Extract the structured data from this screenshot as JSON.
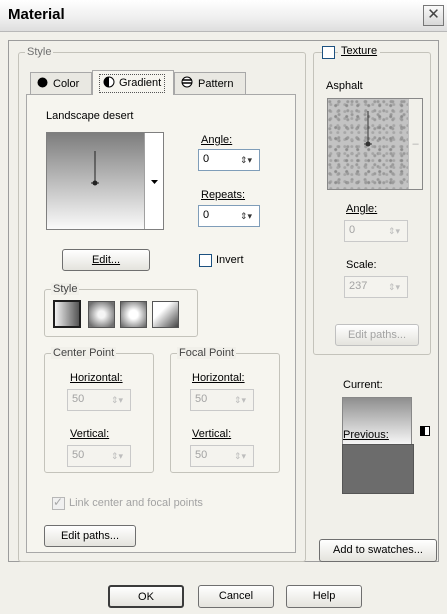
{
  "window": {
    "title": "Material",
    "close_glyph": "✕"
  },
  "style_group": {
    "label": "Style"
  },
  "tabs": [
    {
      "label": "Color",
      "icon": "filled-circle-icon"
    },
    {
      "label": "Gradient",
      "icon": "half-circle-icon"
    },
    {
      "label": "Pattern",
      "icon": "striped-circle-icon"
    }
  ],
  "gradient": {
    "name": "Landscape desert",
    "angle_label": "Angle:",
    "angle_value": "0",
    "repeats_label": "Repeats:",
    "repeats_value": "0",
    "edit_button": "Edit...",
    "invert_label": "Invert",
    "invert_checked": false,
    "style_label": "Style",
    "styles": [
      "linear",
      "rectangular",
      "sunburst",
      "radial"
    ],
    "center_point": {
      "label": "Center Point",
      "horizontal_label": "Horizontal:",
      "horizontal_value": "50",
      "vertical_label": "Vertical:",
      "vertical_value": "50"
    },
    "focal_point": {
      "label": "Focal Point",
      "horizontal_label": "Horizontal:",
      "horizontal_value": "50",
      "vertical_label": "Vertical:",
      "vertical_value": "50"
    },
    "link_label": "Link center and focal points",
    "link_checked": true,
    "edit_paths_button": "Edit paths..."
  },
  "texture": {
    "label": "Texture",
    "checked": false,
    "name": "Asphalt",
    "angle_label": "Angle:",
    "angle_value": "0",
    "scale_label": "Scale:",
    "scale_value": "237",
    "edit_paths_button": "Edit paths..."
  },
  "preview": {
    "current_label": "Current:",
    "previous_label": "Previous:",
    "add_swatches_button": "Add to swatches...",
    "previous_color": "#6c6c6c"
  },
  "footer": {
    "ok": "OK",
    "cancel": "Cancel",
    "help": "Help"
  }
}
